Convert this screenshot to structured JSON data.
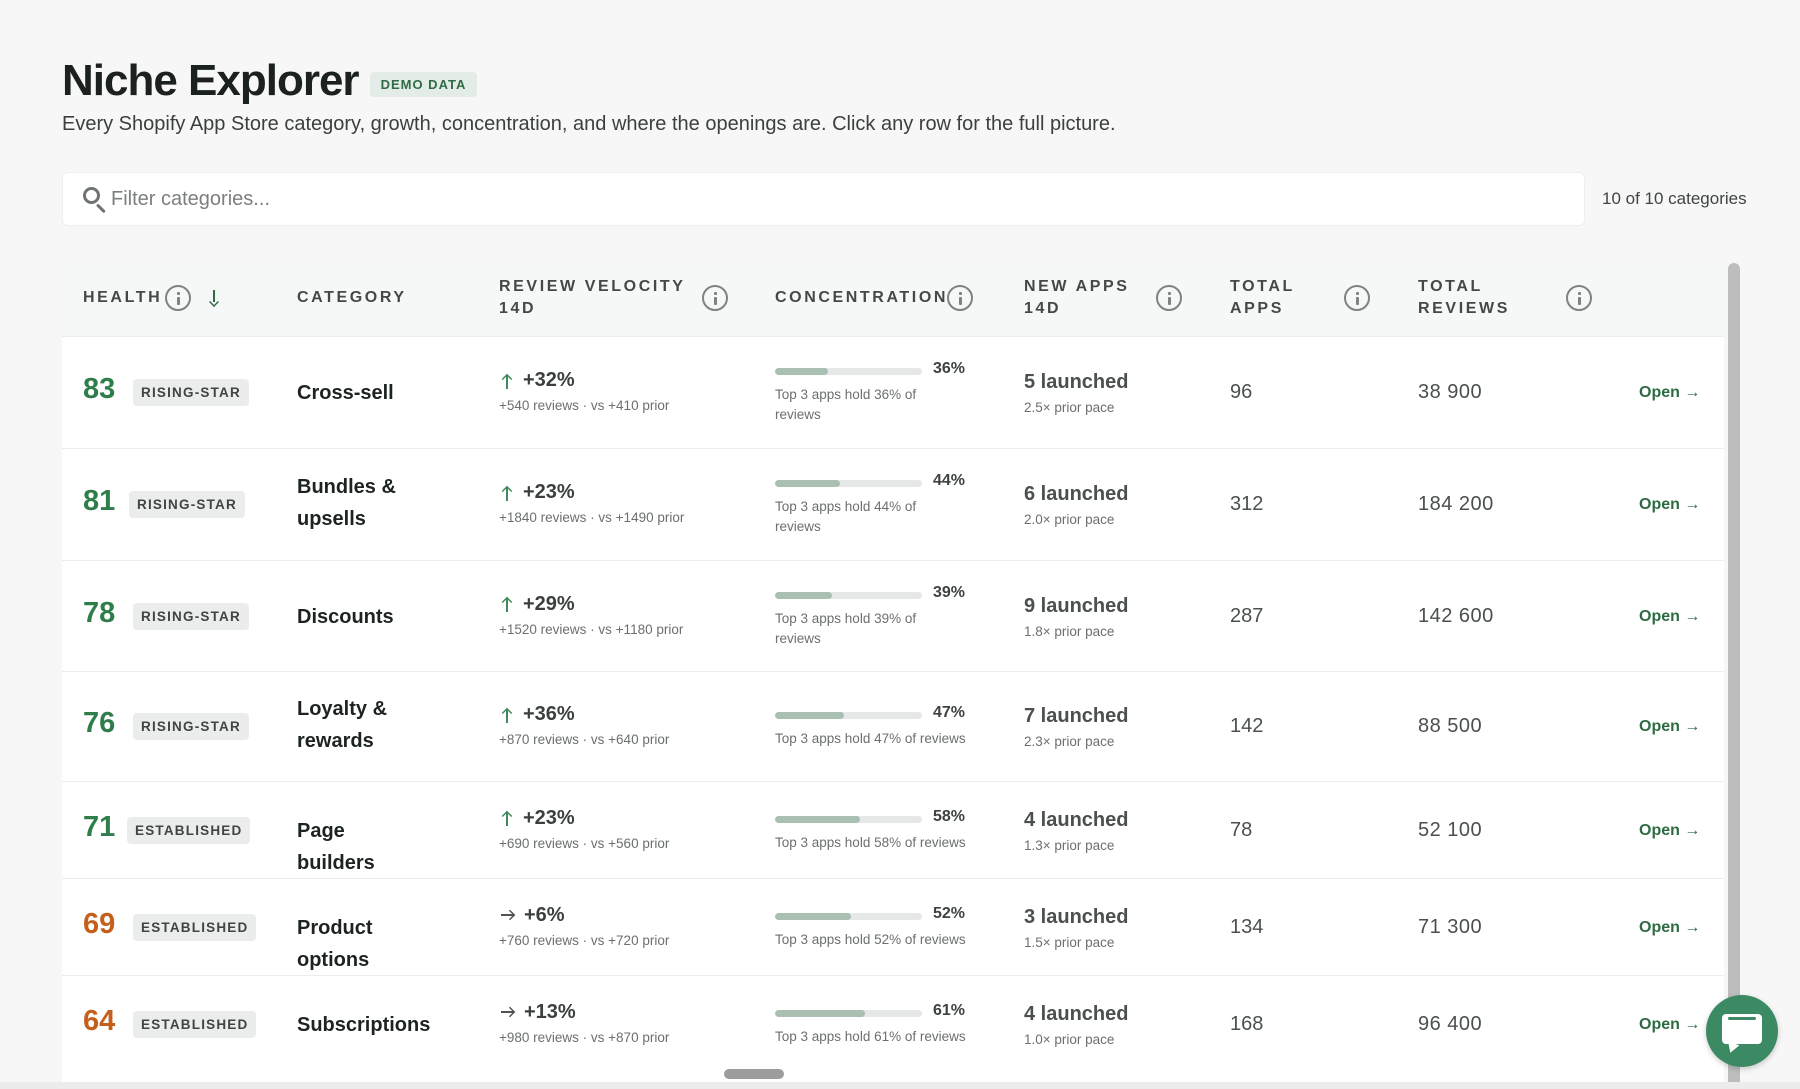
{
  "header": {
    "title": "Niche Explorer",
    "badge": "DEMO DATA",
    "subtitle": "Every Shopify App Store category, growth, concentration, and where the openings are. Click any row for the full picture."
  },
  "search": {
    "placeholder": "Filter categories...",
    "value": "",
    "count_text": "10 of 10 categories"
  },
  "table": {
    "columns": {
      "health": "HEALTH",
      "category": "CATEGORY",
      "review_velocity": "REVIEW VELOCITY 14D",
      "concentration": "CONCENTRATION",
      "new_apps": "NEW APPS 14D",
      "total_apps": "TOTAL APPS",
      "total_reviews": "TOTAL REVIEWS"
    },
    "rows": [
      {
        "score": "83",
        "tier": "RISING-STAR",
        "category": "Cross-sell",
        "velocity": "+32%",
        "velocity_sub": "+540 reviews · vs +410 prior",
        "conc_pct": "36%",
        "conc_sub": "Top 3 apps hold 36% of reviews",
        "new_apps": "5 launched",
        "new_sub": "2.5× prior pace",
        "total_apps": "96",
        "total_reviews": "38 900",
        "open": "Open →"
      },
      {
        "score": "81",
        "tier": "RISING-STAR",
        "category": "Bundles & upsells",
        "velocity": "+23%",
        "velocity_sub": "+1840 reviews · vs +1490 prior",
        "conc_pct": "44%",
        "conc_sub": "Top 3 apps hold 44% of reviews",
        "new_apps": "6 launched",
        "new_sub": "2.0× prior pace",
        "total_apps": "312",
        "total_reviews": "184 200",
        "open": "Open →"
      },
      {
        "score": "78",
        "tier": "RISING-STAR",
        "category": "Discounts",
        "velocity": "+29%",
        "velocity_sub": "+1520 reviews · vs +1180 prior",
        "conc_pct": "39%",
        "conc_sub": "Top 3 apps hold 39% of reviews",
        "new_apps": "9 launched",
        "new_sub": "1.8× prior pace",
        "total_apps": "287",
        "total_reviews": "142 600",
        "open": "Open →"
      },
      {
        "score": "76",
        "tier": "RISING-STAR",
        "category": "Loyalty & rewards",
        "velocity": "+36%",
        "velocity_sub": "+870 reviews · vs +640 prior",
        "conc_pct": "47%",
        "conc_sub": "Top 3 apps hold 47% of reviews",
        "new_apps": "7 launched",
        "new_sub": "2.3× prior pace",
        "total_apps": "142",
        "total_reviews": "88 500",
        "open": "Open →"
      },
      {
        "score": "71",
        "tier": "ESTABLISHED",
        "category": "Page builders",
        "velocity": "+23%",
        "velocity_sub": "+690 reviews · vs +560 prior",
        "conc_pct": "58%",
        "conc_sub": "Top 3 apps hold 58% of reviews",
        "new_apps": "4 launched",
        "new_sub": "1.3× prior pace",
        "total_apps": "78",
        "total_reviews": "52 100",
        "open": "Open →"
      },
      {
        "score": "69",
        "tier": "ESTABLISHED",
        "category": "Product options",
        "velocity": "+6%",
        "velocity_sub": "+760 reviews · vs +720 prior",
        "conc_pct": "52%",
        "conc_sub": "Top 3 apps hold 52% of reviews",
        "new_apps": "3 launched",
        "new_sub": "1.5× prior pace",
        "total_apps": "134",
        "total_reviews": "71 300",
        "open": "Open →"
      },
      {
        "score": "64",
        "tier": "ESTABLISHED",
        "category": "Subscriptions",
        "velocity": "+13%",
        "velocity_sub": "+980 reviews · vs +870 prior",
        "conc_pct": "61%",
        "conc_sub": "Top 3 apps hold 61% of reviews",
        "new_apps": "4 launched",
        "new_sub": "1.0× prior pace",
        "total_apps": "168",
        "total_reviews": "96 400",
        "open": "Open →"
      }
    ]
  },
  "colors": {
    "accent_green": "#2e6b43",
    "score_green": "#2e7d4a",
    "score_orange": "#c4601c",
    "chat_button": "#3c8a63"
  },
  "icons": {
    "search": "search-icon",
    "info": "info-icon",
    "sort": "sort-down-arrow-icon",
    "trend_up": "arrow-up-icon",
    "trend_flat": "arrow-right-icon",
    "chat": "chat-icon"
  }
}
